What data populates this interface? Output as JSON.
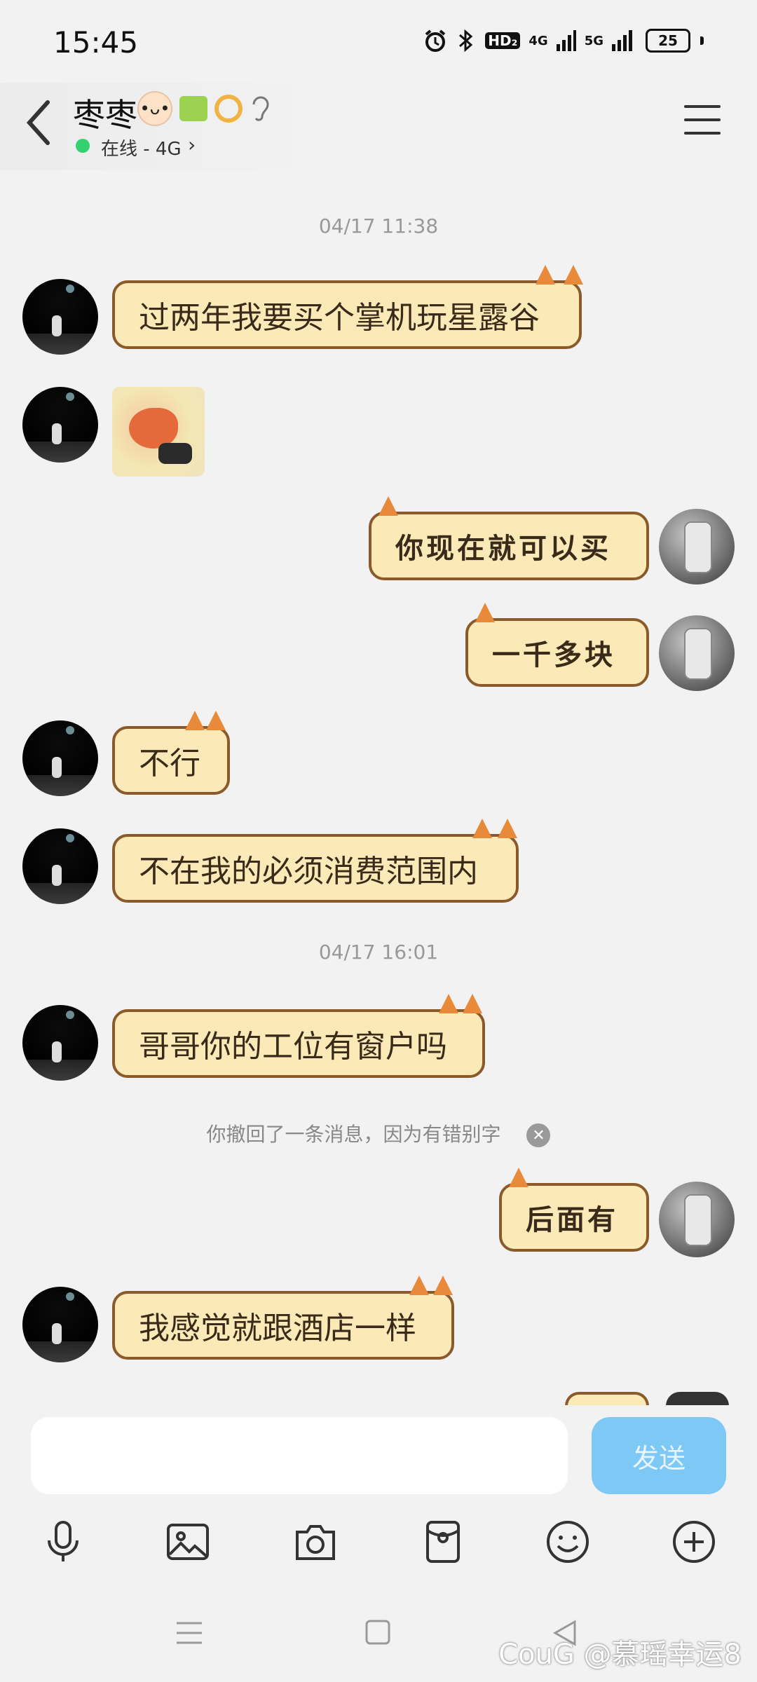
{
  "status_bar": {
    "time": "15:45",
    "network": "HD₂",
    "signal1": "4G",
    "signal2": "5G",
    "battery": "25"
  },
  "header": {
    "name": "枣枣",
    "status": "在线 - 4G",
    "status_chevron": "›"
  },
  "timestamps": [
    "04/17 11:38",
    "04/17 16:01"
  ],
  "messages": [
    {
      "side": "left",
      "text": "过两年我要买个掌机玩星露谷"
    },
    {
      "side": "left",
      "type": "sticker"
    },
    {
      "side": "right",
      "text": "你现在就可以买"
    },
    {
      "side": "right",
      "text": "一千多块"
    },
    {
      "side": "left",
      "text": "不行"
    },
    {
      "side": "left",
      "text": "不在我的必须消费范围内"
    },
    {
      "side": "left",
      "text": "哥哥你的工位有窗户吗"
    },
    {
      "side": "right",
      "text": "后面有"
    },
    {
      "side": "left",
      "text": "我感觉就跟酒店一样"
    }
  ],
  "notice": {
    "text": "你撤回了一条消息，因为有错别字",
    "close_glyph": "✕"
  },
  "input": {
    "value": "",
    "send_label": "发送"
  },
  "toolbar": [
    "mic-icon",
    "image-icon",
    "camera-icon",
    "red-packet-icon",
    "emoji-icon",
    "plus-icon"
  ],
  "watermark": "CouG @慕瑶幸运8"
}
